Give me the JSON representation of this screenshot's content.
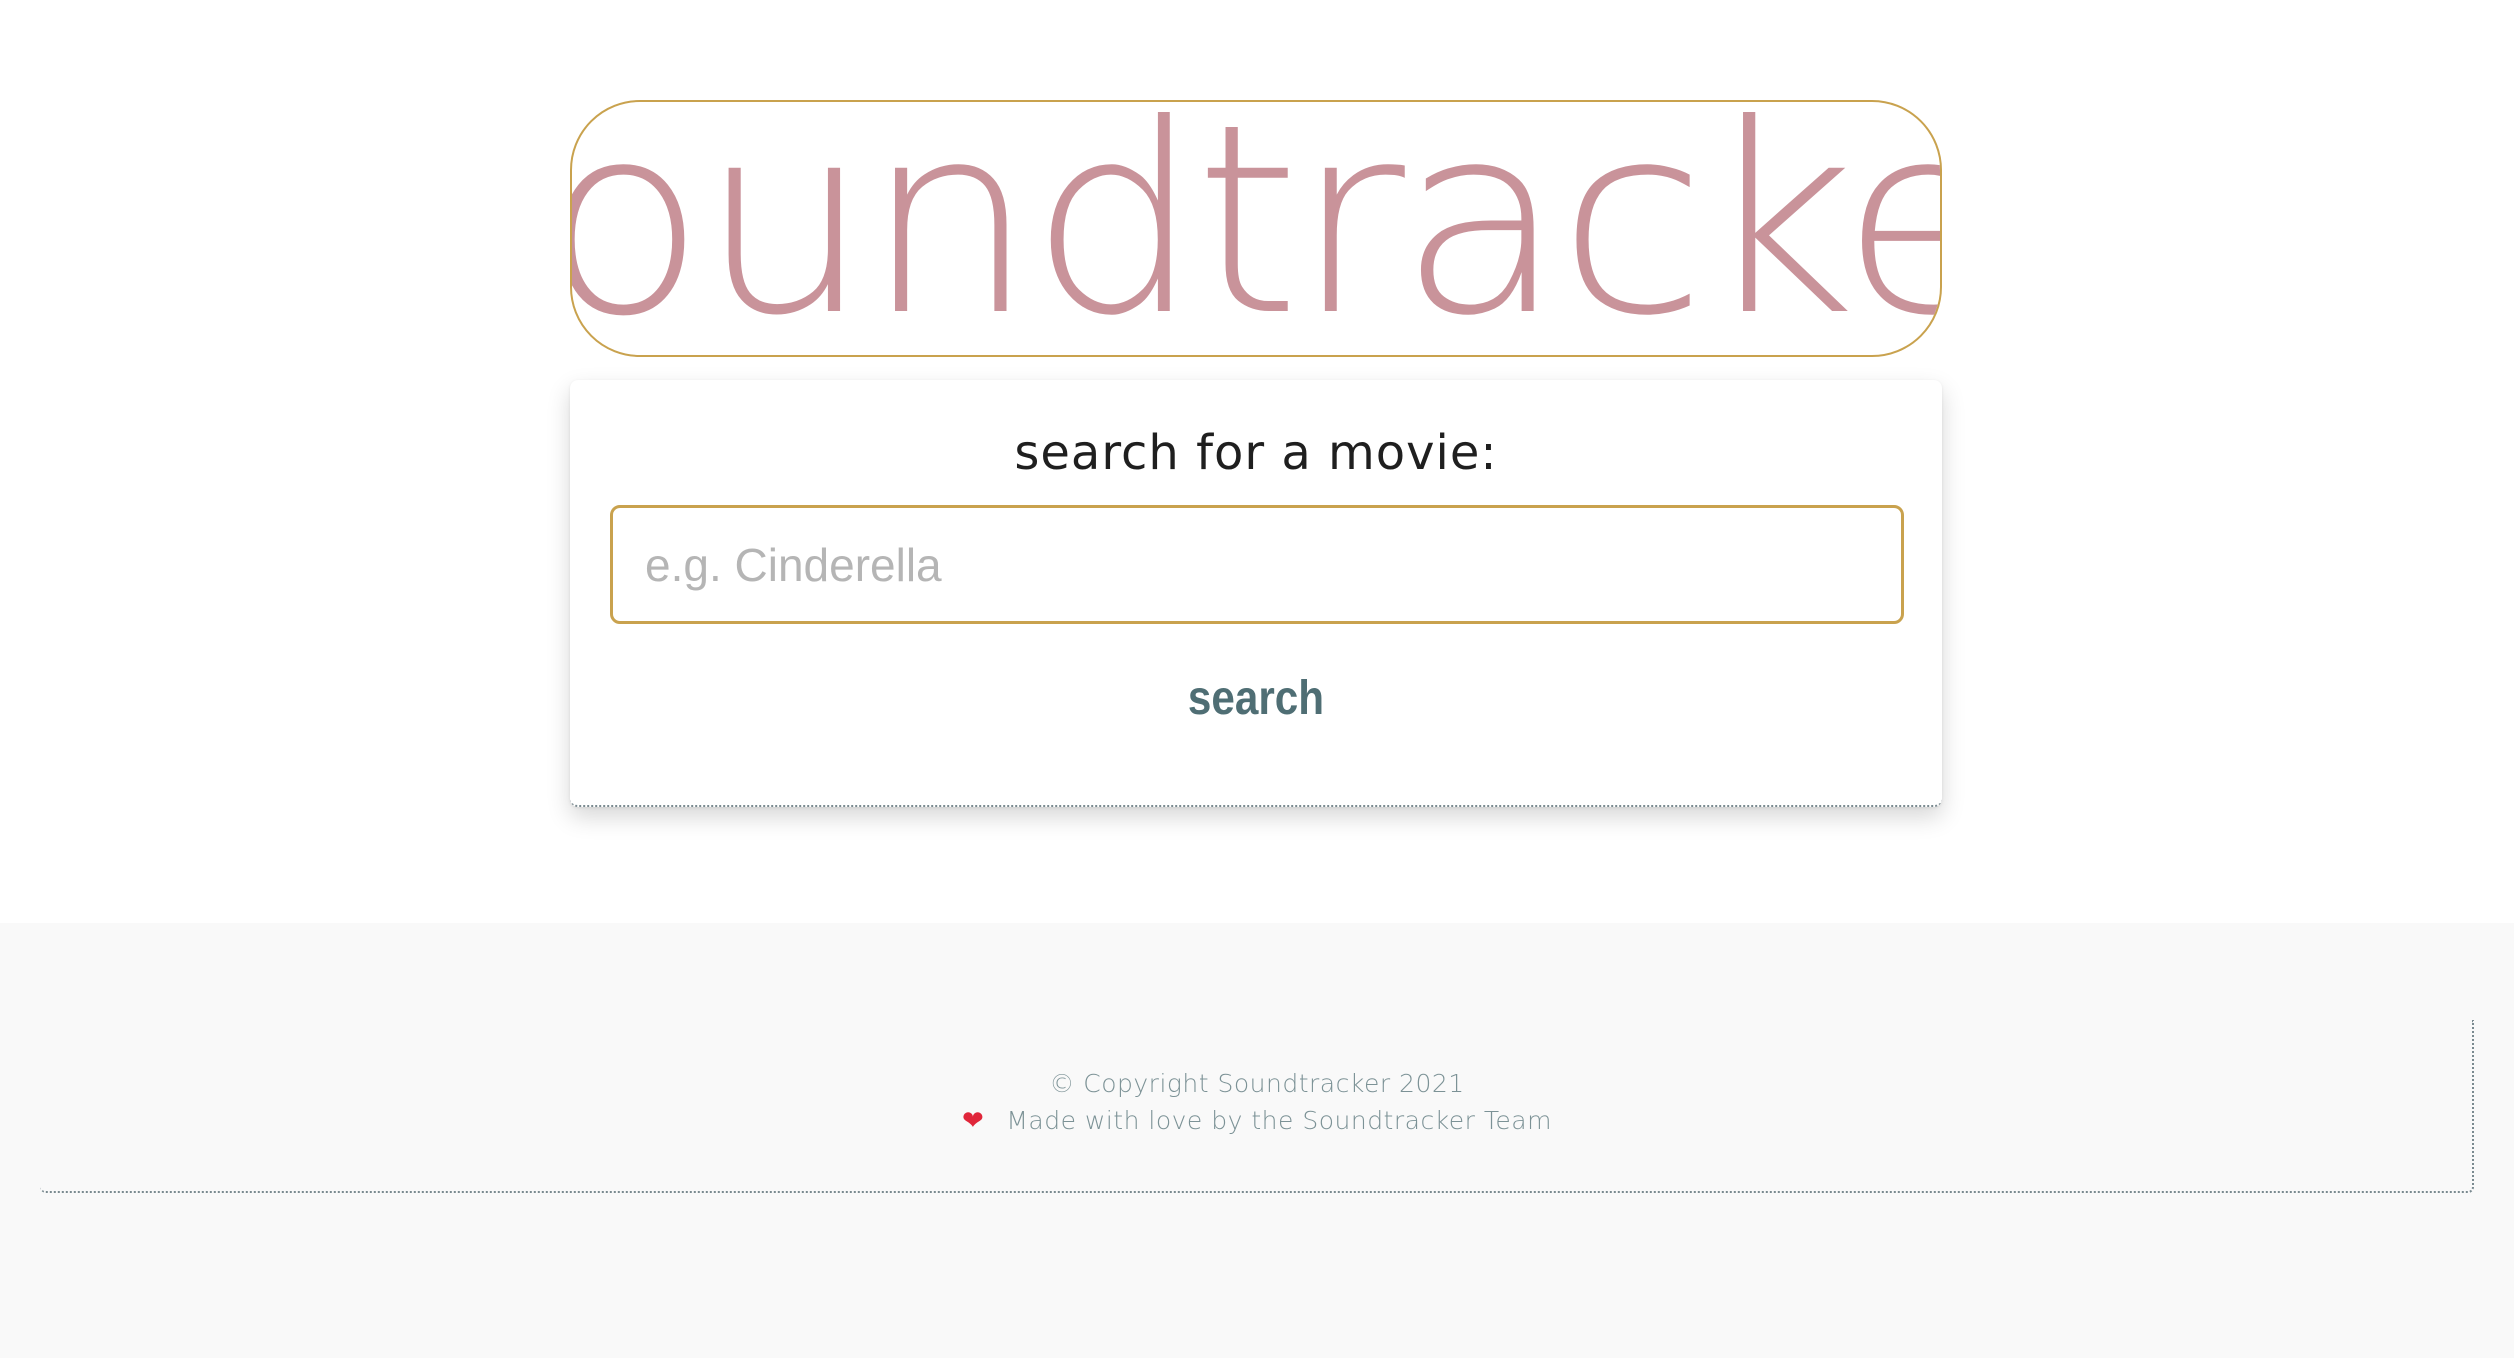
{
  "header": {
    "logo_text": "soundtracker"
  },
  "search": {
    "heading": "search for a movie:",
    "placeholder": "e.g. Cinderella",
    "value": "",
    "button_label": "search"
  },
  "footer": {
    "copyright": "© Copyright Soundtracker 2021",
    "heart_icon": "❤",
    "made_with_love": "Made with love by the Soundtracker Team"
  },
  "colors": {
    "logo": "#c9939a",
    "accent_border": "#c9a24e",
    "button": "#4f6e74",
    "footer_text": "#7c9296",
    "footer_bg": "#f9f9f9"
  }
}
